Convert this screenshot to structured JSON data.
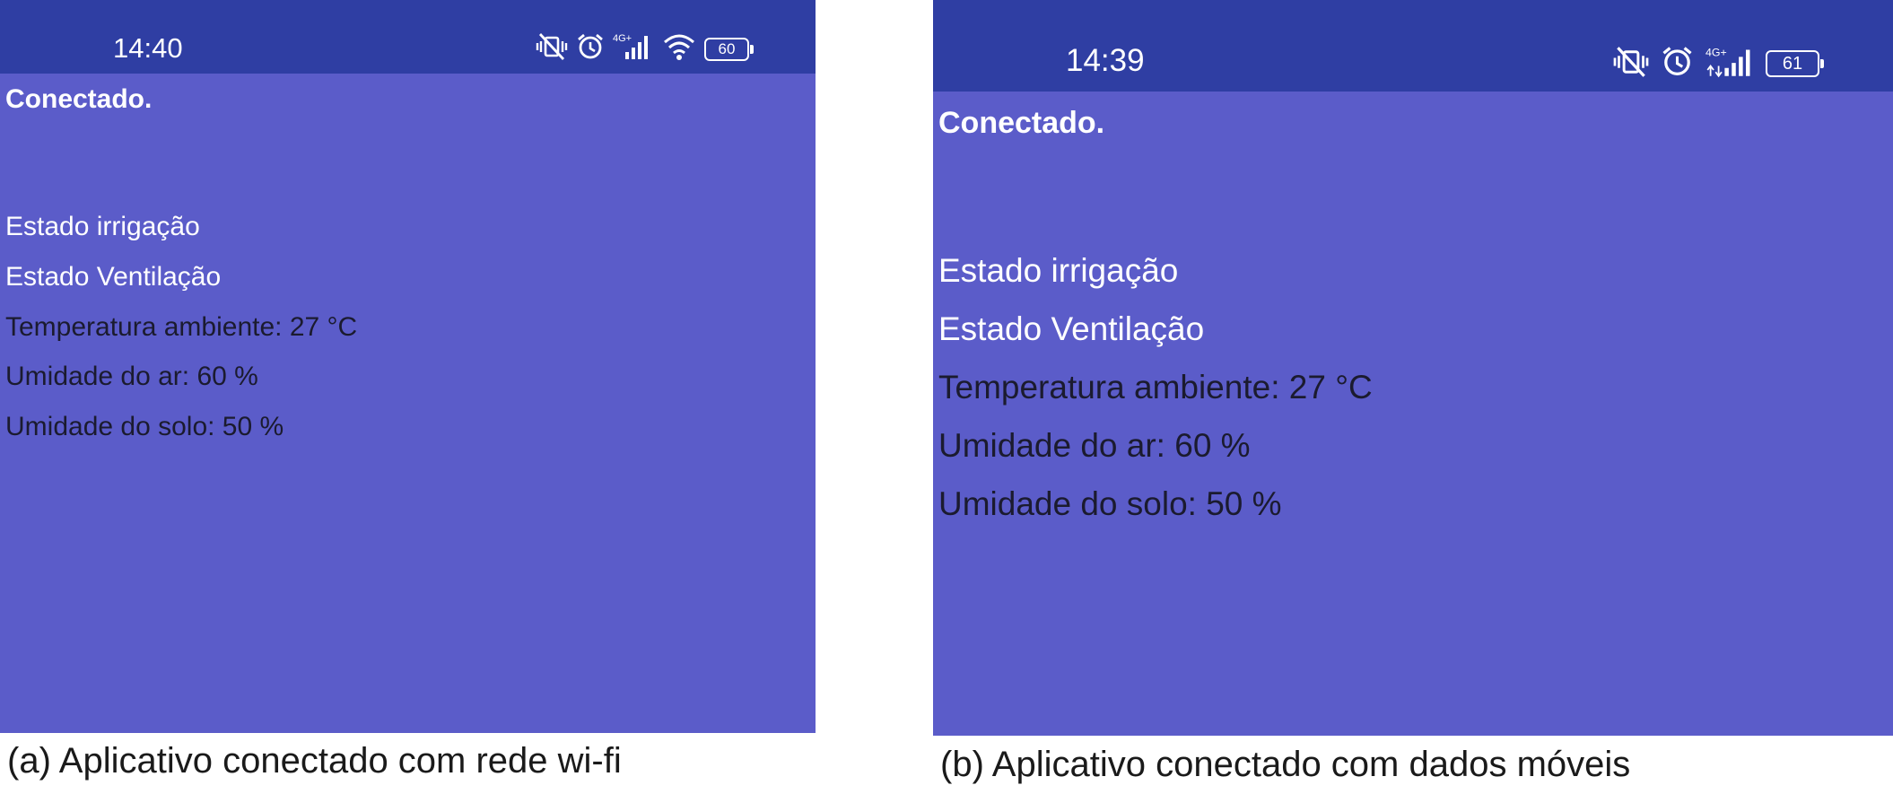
{
  "panel_a": {
    "status_bar": {
      "time": "14:40",
      "network_label": "4G+",
      "battery_level": "60",
      "icons": [
        "vibrate-off-icon",
        "alarm-icon",
        "signal-icon",
        "wifi-icon",
        "battery-icon"
      ]
    },
    "app": {
      "connection_status": "Conectado.",
      "lines": [
        "Estado irrigação",
        "Estado Ventilação",
        "Temperatura ambiente: 27 °C",
        "Umidade do ar: 60 %",
        "Umidade do solo: 50 %"
      ]
    },
    "caption": "(a) Aplicativo conectado com rede wi-fi"
  },
  "panel_b": {
    "status_bar": {
      "time": "14:39",
      "network_label": "4G+",
      "battery_level": "61",
      "icons": [
        "vibrate-off-icon",
        "alarm-icon",
        "signal-icon",
        "battery-icon"
      ]
    },
    "app": {
      "connection_status": "Conectado.",
      "lines": [
        "Estado irrigação",
        "Estado Ventilação",
        "Temperatura ambiente: 27 °C",
        "Umidade do ar: 60 %",
        "Umidade do solo: 50 %"
      ]
    },
    "caption": "(b) Aplicativo conectado com dados móveis"
  },
  "colors": {
    "status_bar_bg": "#2f3ea3",
    "app_bg": "#5b5cc9",
    "status_text_white": "#ffffff",
    "value_text_dark": "#1b1b2f"
  }
}
